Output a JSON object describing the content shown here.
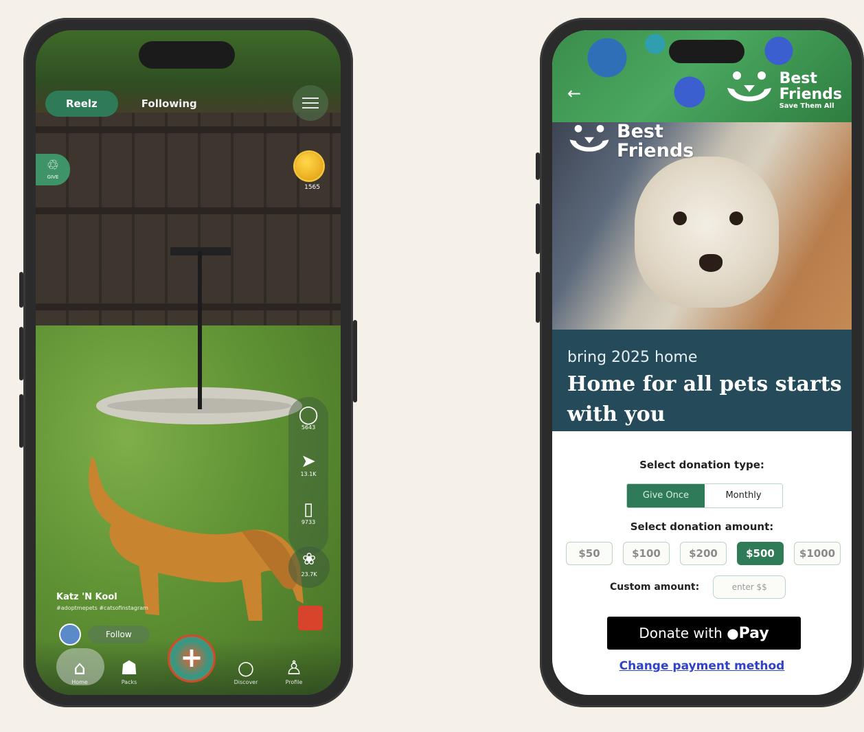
{
  "reelz_app": {
    "tabs": [
      "Reelz",
      "Following"
    ],
    "give_badge": "GIVE",
    "coin_count": "1565",
    "actions": [
      {
        "icon": "comment-icon",
        "count": "5643"
      },
      {
        "icon": "share-icon",
        "count": "13.1K"
      },
      {
        "icon": "bookmark-icon",
        "count": "9733"
      }
    ],
    "paw_count": "23.7K",
    "creator_name": "Katz 'N Kool",
    "creator_tags": "#adoptmepets #catsofinstagram",
    "follow_label": "Follow",
    "nav": [
      {
        "icon": "home-icon",
        "label": "Home"
      },
      {
        "icon": "packs-icon",
        "label": "Packs"
      },
      {
        "icon": "create-icon",
        "label": "+"
      },
      {
        "icon": "search-icon",
        "label": "Discover"
      },
      {
        "icon": "profile-icon",
        "label": "Profile"
      }
    ]
  },
  "donation_app": {
    "brand_line1": "Best",
    "brand_line2": "Friends",
    "brand_tagline": "Save Them All",
    "photo_brand_line1": "Best",
    "photo_brand_line2": "Friends",
    "kicker": "bring 2025 home",
    "headline": "Home for all pets starts with you",
    "donation_type_label": "Select donation type:",
    "donation_types": [
      "Give Once",
      "Monthly"
    ],
    "selected_type": "Give Once",
    "amount_label": "Select donation amount:",
    "amounts": [
      "$50",
      "$100",
      "$200",
      "$500",
      "$1000"
    ],
    "selected_amount": "$500",
    "custom_label": "Custom amount:",
    "custom_placeholder": "enter $$",
    "apple_pay_prefix": "Donate with",
    "apple_pay_suffix": "Pay",
    "change_payment": "Change payment method",
    "colors": {
      "accent": "#2f7b58",
      "banner": "#254a5a",
      "link": "#2f43c8"
    }
  }
}
